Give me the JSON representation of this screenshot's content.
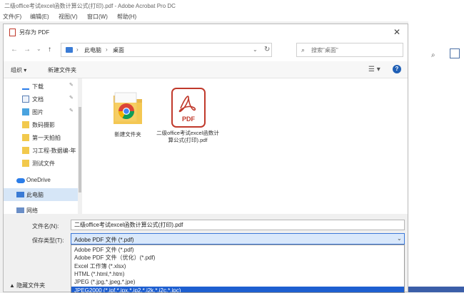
{
  "app": {
    "title": "二级office考试excel函数计算公式(打印).pdf - Adobe Acrobat Pro DC",
    "menu": [
      "文件(F)",
      "编辑(E)",
      "视图(V)",
      "窗口(W)",
      "帮助(H)"
    ]
  },
  "dialog": {
    "title": "另存为 PDF",
    "close_glyph": "✕"
  },
  "nav": {
    "back": "←",
    "forward": "→",
    "recent": "⌄",
    "up": "↑",
    "breadcrumb": [
      "此电脑",
      "桌面"
    ],
    "breadcrumb_sep": "›",
    "dropdown_glyph": "⌄",
    "refresh_glyph": "↻"
  },
  "search": {
    "placeholder": "搜索\"桌面\"",
    "glyph": "⌕"
  },
  "toolbar": {
    "organize": "组织 ▾",
    "new_folder": "新建文件夹",
    "view_glyph": "☰ ▾",
    "help_glyph": "?"
  },
  "sidebar": {
    "items": [
      {
        "label": "下载",
        "icon": "download-icon",
        "pinned": true
      },
      {
        "label": "文档",
        "icon": "document-icon",
        "pinned": true
      },
      {
        "label": "图片",
        "icon": "picture-icon",
        "pinned": true
      },
      {
        "label": "数码摄影",
        "icon": "folder-icon",
        "pinned": false
      },
      {
        "label": "第一天拍拍",
        "icon": "folder-icon",
        "pinned": false
      },
      {
        "label": "习工程-数据编-年",
        "icon": "folder-icon",
        "pinned": false
      },
      {
        "label": "测试文件",
        "icon": "folder-icon",
        "pinned": false
      },
      {
        "label": "OneDrive",
        "icon": "onedrive-icon",
        "pinned": false
      },
      {
        "label": "此电脑",
        "icon": "pc-icon",
        "pinned": false,
        "selected": true
      },
      {
        "label": "网络",
        "icon": "network-icon",
        "pinned": false
      }
    ],
    "pin_glyph": "✎"
  },
  "files": [
    {
      "name": "新建文件夹",
      "type": "folder"
    },
    {
      "name": "二级office考试excel函数计算公式(打印).pdf",
      "type": "pdf",
      "badge": "PDF"
    }
  ],
  "form": {
    "filename_label": "文件名(N):",
    "filename_value": "二级office考试excel函数计算公式(打印).pdf",
    "filetype_label": "保存类型(T):",
    "filetype_value": "Adobe PDF 文件 (*.pdf)",
    "caret": "⌄",
    "type_options": [
      "Adobe PDF 文件 (*.pdf)",
      "Adobe PDF 文件（优化）(*.pdf)",
      "Excel 工作簿 (*.xlsx)",
      "HTML (*.html,*.htm)",
      "JPEG (*.jpg,*.jpeg,*.jpe)",
      "JPEG2000 (*.jpf,*.jpx,*.jp2,*.j2k,*.j2c,*.jpc)"
    ],
    "selected_option_index": 5
  },
  "footer": {
    "hide_folders": "▲ 隐藏文件夹"
  },
  "colors": {
    "accent": "#1e5fd0",
    "pdf_red": "#c0392b",
    "folder_yellow": "#f2c94c"
  }
}
